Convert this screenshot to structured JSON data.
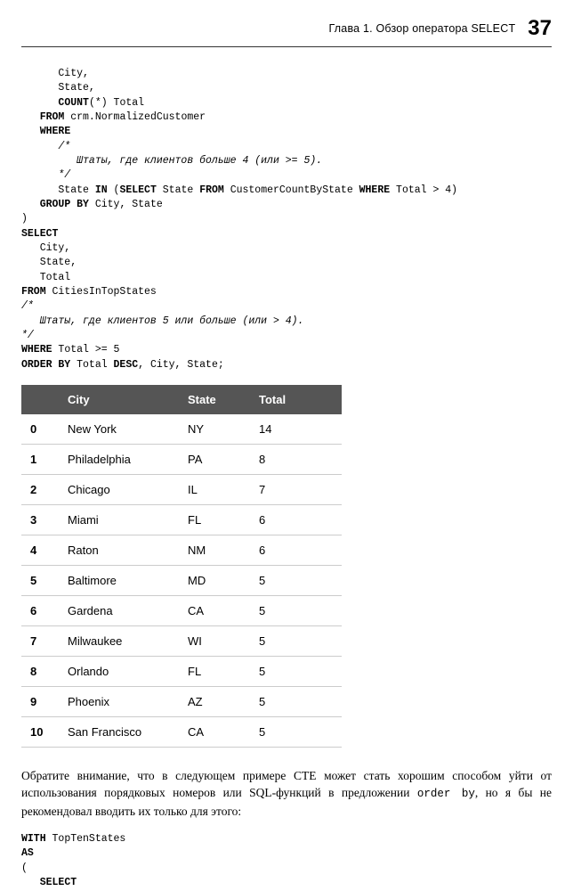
{
  "header": {
    "chapter": "Глава 1. Обзор оператора SELECT",
    "page": "37"
  },
  "code_block_1": {
    "l1": "      City,",
    "l2": "      State,",
    "l3a": "      ",
    "l3b": "COUNT",
    "l3c": "(*) Total",
    "l4a": "   ",
    "l4b": "FROM",
    "l4c": " crm.NormalizedCustomer",
    "l5a": "   ",
    "l5b": "WHERE",
    "l6": "      /*",
    "l7": "         Штаты, где клиентов больше 4 (или >= 5).",
    "l8": "      */",
    "l9a": "      State ",
    "l9b": "IN",
    "l9c": " (",
    "l9d": "SELECT",
    "l9e": " State ",
    "l9f": "FROM",
    "l9g": " CustomerCountByState ",
    "l9h": "WHERE",
    "l9i": " Total > 4)",
    "l10a": "   ",
    "l10b": "GROUP BY",
    "l10c": " City, State",
    "l11": ")",
    "l12": "SELECT",
    "l13": "   City,",
    "l14": "   State,",
    "l15": "   Total",
    "l16a": "FROM",
    "l16b": " CitiesInTopStates",
    "l17": "/*",
    "l18": "   Штаты, где клиентов 5 или больше (или > 4).",
    "l19": "*/",
    "l20a": "WHERE",
    "l20b": " Total >= 5",
    "l21a": "ORDER BY",
    "l21b": " Total ",
    "l21c": "DESC",
    "l21d": ", City, State;"
  },
  "table": {
    "headers": {
      "idx": "",
      "city": "City",
      "state": "State",
      "total": "Total"
    },
    "rows": [
      {
        "idx": "0",
        "city": "New York",
        "state": "NY",
        "total": "14"
      },
      {
        "idx": "1",
        "city": "Philadelphia",
        "state": "PA",
        "total": "8"
      },
      {
        "idx": "2",
        "city": "Chicago",
        "state": "IL",
        "total": "7"
      },
      {
        "idx": "3",
        "city": "Miami",
        "state": "FL",
        "total": "6"
      },
      {
        "idx": "4",
        "city": "Raton",
        "state": "NM",
        "total": "6"
      },
      {
        "idx": "5",
        "city": "Baltimore",
        "state": "MD",
        "total": "5"
      },
      {
        "idx": "6",
        "city": "Gardena",
        "state": "CA",
        "total": "5"
      },
      {
        "idx": "7",
        "city": "Milwaukee",
        "state": "WI",
        "total": "5"
      },
      {
        "idx": "8",
        "city": "Orlando",
        "state": "FL",
        "total": "5"
      },
      {
        "idx": "9",
        "city": "Phoenix",
        "state": "AZ",
        "total": "5"
      },
      {
        "idx": "10",
        "city": "San Francisco",
        "state": "CA",
        "total": "5"
      }
    ]
  },
  "paragraph": {
    "p1a": "Обратите внимание, что в следующем примере CTE может стать хорошим способом уйти от использования порядковых номеров или SQL-функций в предложении ",
    "p1b": "order by",
    "p1c": ", но я бы не рекомендовал вводить их только для этого:"
  },
  "code_block_2": {
    "l1a": "WITH",
    "l1b": " TopTenStates",
    "l2": "AS",
    "l3": "(",
    "l4a": "   ",
    "l4b": "SELECT"
  }
}
